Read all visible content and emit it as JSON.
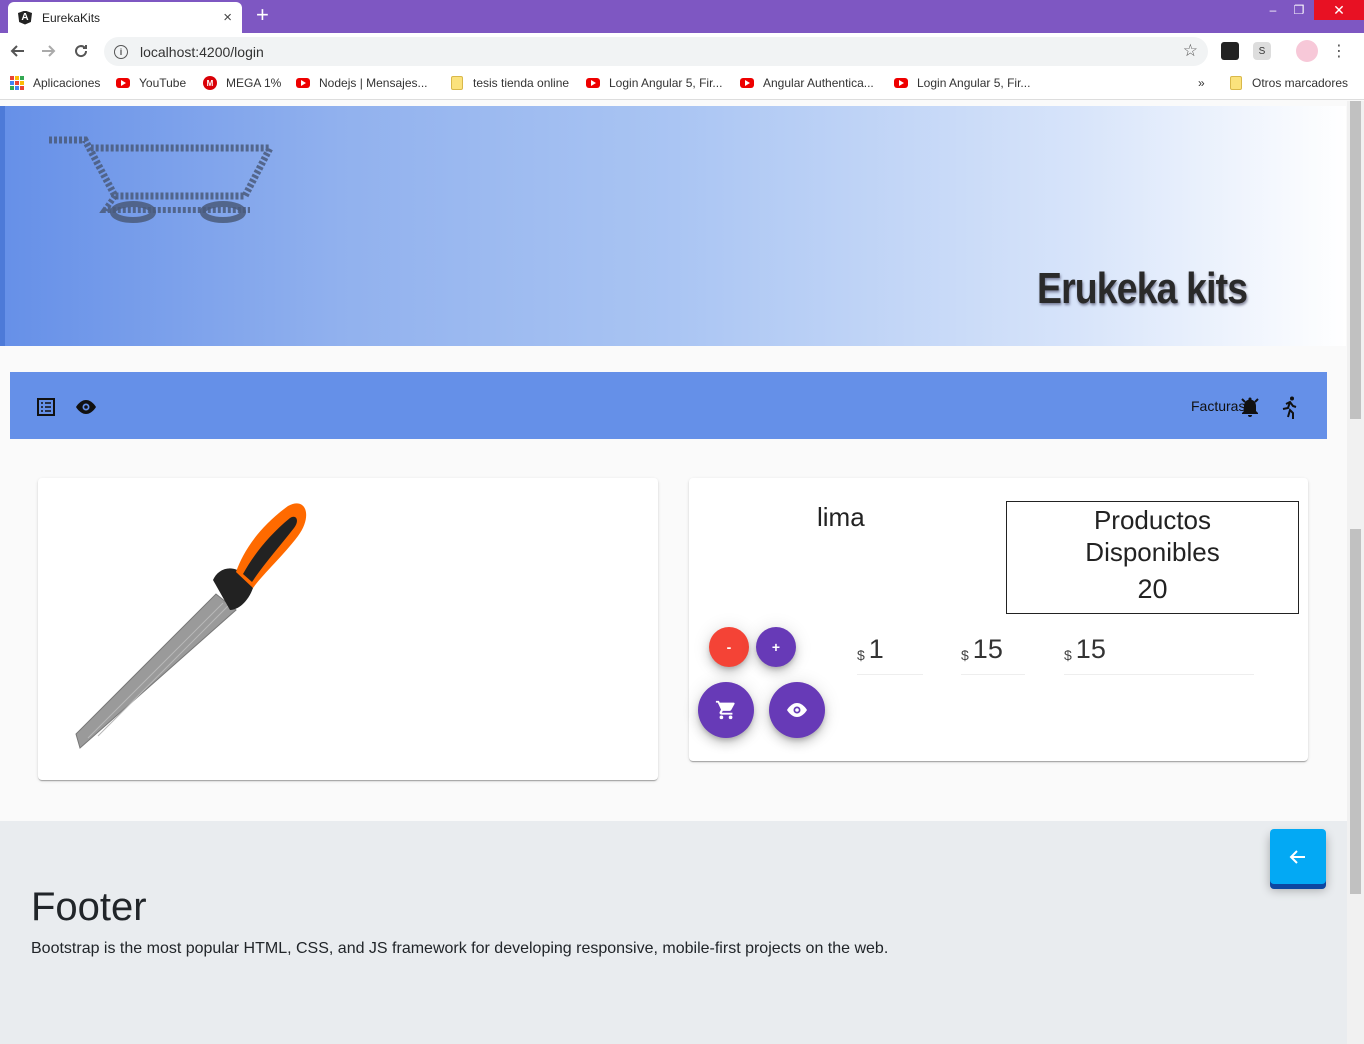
{
  "browser": {
    "tab_title": "EurekaKits",
    "tab_logo": "A",
    "new_tab": "+",
    "close_tab": "×",
    "url": "localhost:4200/login",
    "window_controls": {
      "minimize": "–",
      "maximize": "❐",
      "close": "✕"
    }
  },
  "bookmarks": [
    {
      "label": "Aplicaciones",
      "icon": "apps-icon"
    },
    {
      "label": "YouTube",
      "icon": "youtube-icon"
    },
    {
      "label": "MEGA 1%",
      "icon": "mega-icon"
    },
    {
      "label": "Nodejs | Mensajes...",
      "icon": "youtube-icon"
    },
    {
      "label": "tesis tienda online",
      "icon": "folder-icon"
    },
    {
      "label": "Login Angular 5, Fir...",
      "icon": "youtube-icon"
    },
    {
      "label": "Angular Authentica...",
      "icon": "youtube-icon"
    },
    {
      "label": "Login Angular 5, Fir...",
      "icon": "youtube-icon"
    }
  ],
  "bookmarks_more": "»",
  "bookmarks_other": "Otros marcadores",
  "banner": {
    "brand": "Erukeka kits"
  },
  "toolbar": {
    "facturas": "Facturas"
  },
  "product": {
    "name": "lima",
    "stock_label": "Productos Disponibles",
    "stock_count": "20",
    "decrement": "-",
    "increment": "+",
    "currency": "$",
    "quantity": "1",
    "unit_price": "15",
    "total": "15"
  },
  "footer": {
    "title": "Footer",
    "text": "Bootstrap is the most popular HTML, CSS, and JS framework for developing responsive, mobile-first projects on the web."
  },
  "colors": {
    "titlebar": "#7e57c2",
    "toolbar": "#6590e8",
    "fab_purple": "#673ab7",
    "fab_red": "#f44336",
    "back_button": "#03a9f4"
  }
}
